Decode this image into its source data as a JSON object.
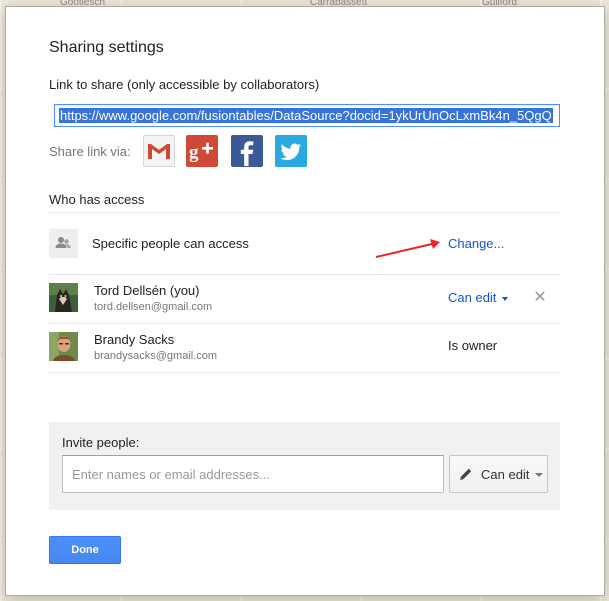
{
  "map": {
    "labels": [
      "Gootlesch",
      "Carrabassett",
      "Guilford"
    ]
  },
  "dialog": {
    "title": "Sharing settings",
    "link_label": "Link to share (only accessible by collaborators)",
    "link_url": "https://www.google.com/fusiontables/DataSource?docid=1ykUrUnOcLxmBk4n_5QgQ",
    "share_via_label": "Share link via:",
    "share_services": [
      {
        "name": "Gmail",
        "icon": "gmail-icon",
        "color": "#d14836"
      },
      {
        "name": "Google+",
        "icon": "google-plus-icon",
        "color": "#d14836"
      },
      {
        "name": "Facebook",
        "icon": "facebook-icon",
        "color": "#3b5998"
      },
      {
        "name": "Twitter",
        "icon": "twitter-icon",
        "color": "#2aa9e0"
      }
    ],
    "who_has_access": "Who has access",
    "access_setting": "Specific people can access",
    "change_label": "Change...",
    "people": [
      {
        "name": "Tord Dellsén (you)",
        "email": "tord.dellsen@gmail.com",
        "permission": "Can edit"
      },
      {
        "name": "Brandy Sacks",
        "email": "brandysacks@gmail.com",
        "permission": "Is owner"
      }
    ],
    "invite": {
      "label": "Invite people:",
      "placeholder": "Enter names or email addresses...",
      "permission": "Can edit"
    },
    "done_label": "Done",
    "colors": {
      "link": "#1155cc",
      "primary": "#4d90fe",
      "annotation_arrow": "#e8262b"
    }
  }
}
